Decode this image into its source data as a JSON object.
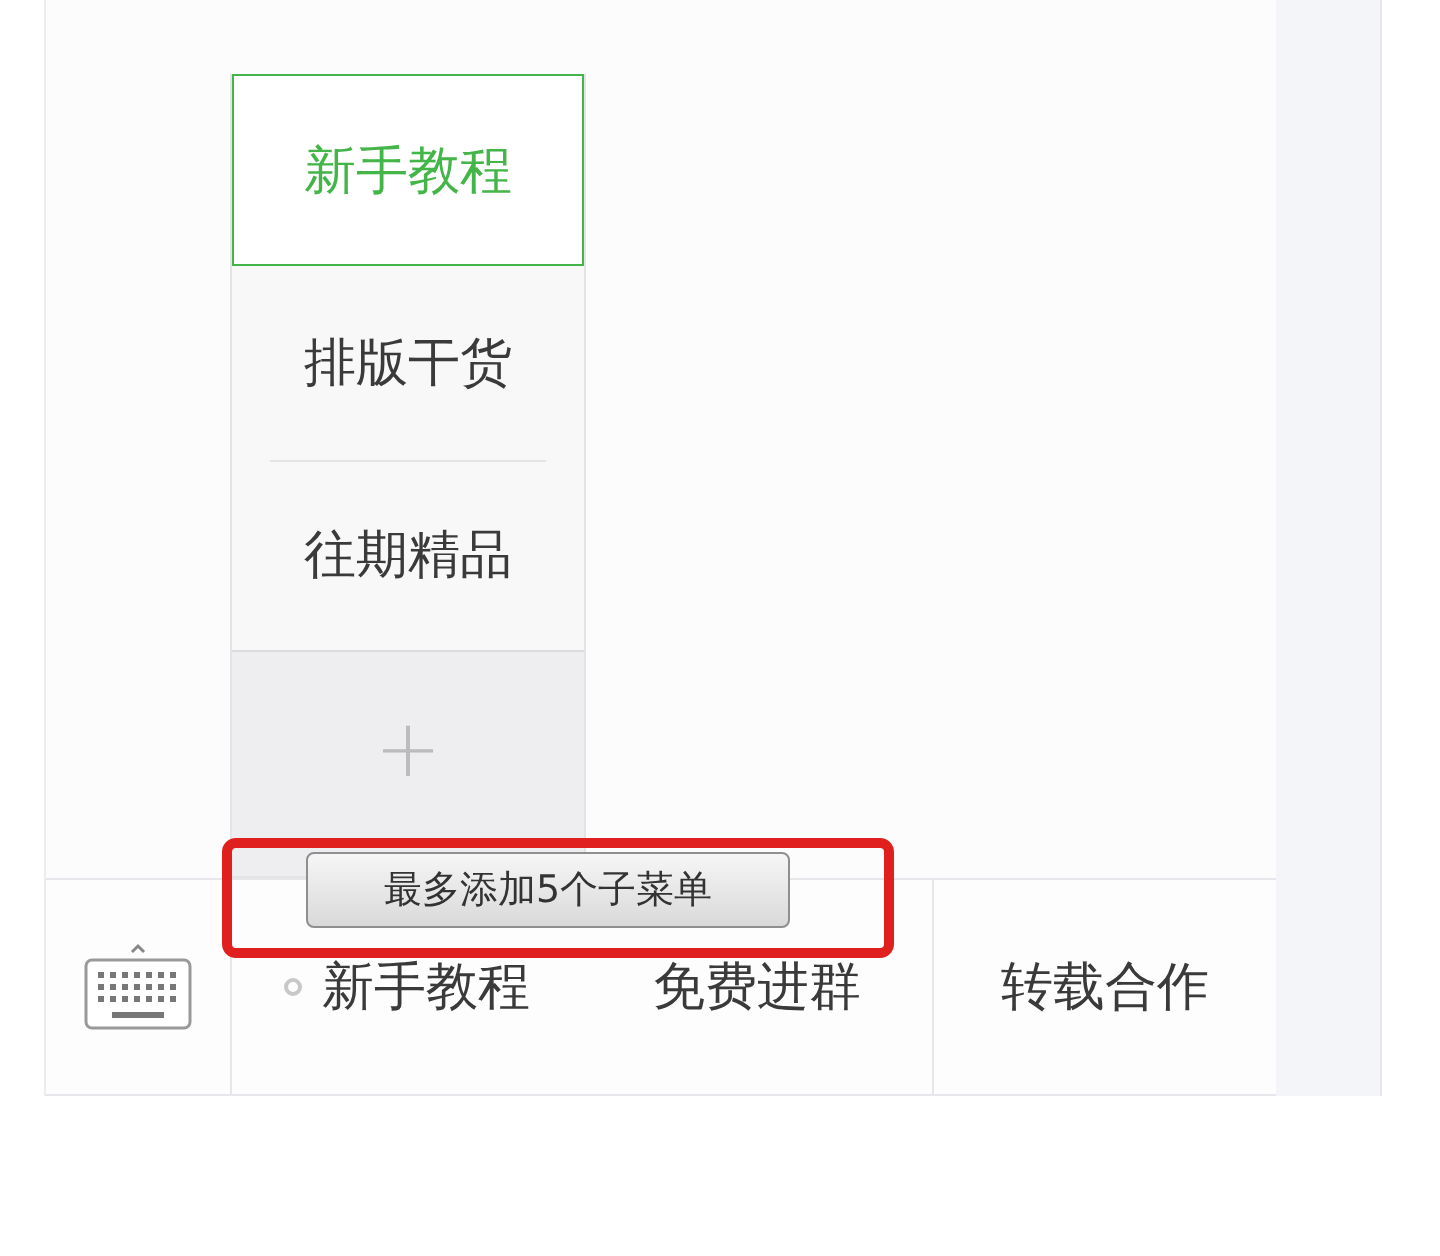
{
  "submenu": {
    "items": [
      {
        "label": "新手教程",
        "selected": true
      },
      {
        "label": "排版干货",
        "selected": false
      },
      {
        "label": "往期精品",
        "selected": false
      }
    ],
    "add_button": "+"
  },
  "tooltip": "最多添加5个子菜单",
  "menu_bar": {
    "items": [
      {
        "label": "新手教程",
        "selected": true
      },
      {
        "label": "免费进群",
        "selected": false
      },
      {
        "label": "转载合作",
        "selected": false
      }
    ]
  }
}
